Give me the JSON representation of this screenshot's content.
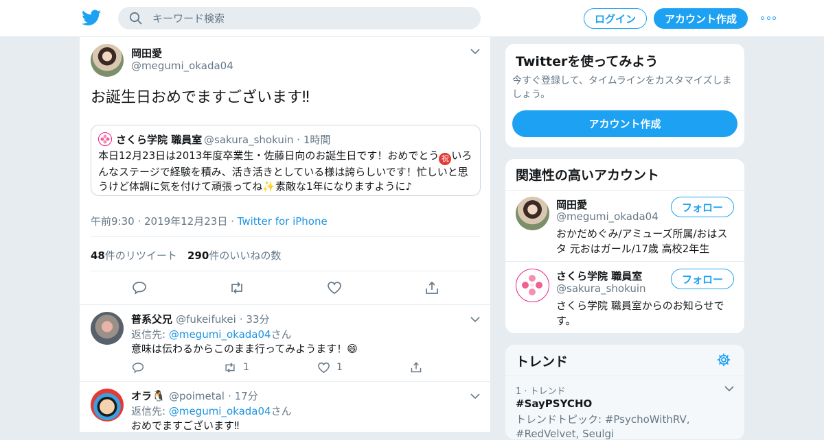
{
  "header": {
    "search_placeholder": "キーワード検索",
    "login_label": "ログイン",
    "signup_label": "アカウント作成"
  },
  "tweet": {
    "author_name": "岡田愛",
    "author_handle": "@megumi_okada04",
    "text": "お誕生日おめでますございます‼",
    "quote": {
      "author_name": "さくら学院 職員室",
      "author_handle": "@sakura_shokuin",
      "time": "1時間",
      "text_1": "本日12月23日は2013年度卒業生・佐藤日向のお誕生日です！おめでとう",
      "iwai": "祝",
      "text_2": "いろんなステージで経験を積み、活き活きとしている様は誇らしいです！忙しいと思うけど体調に気を付けて頑張ってね",
      "sparkle": "✨",
      "text_3": "素敵な1年になりますように♪"
    },
    "timestamp": "午前9:30 · 2019年12月23日",
    "source": "Twitter for iPhone",
    "retweets_count": "48",
    "retweets_label": "件のリツイート",
    "likes_count": "290",
    "likes_label": "件のいいねの数"
  },
  "replies": [
    {
      "name": "普系父兄",
      "handle": "@fukeifukei",
      "time": "33分",
      "reply_prefix": "返信先: ",
      "reply_to": "@megumi_okada04",
      "reply_suffix": "さん",
      "text": "意味は伝わるからこのまま行ってみようます！",
      "emoji": "😄",
      "retweets": "1",
      "likes": "1"
    },
    {
      "name": "オラ",
      "emoji": "🐧",
      "handle": "@poimetal",
      "time": "17分",
      "reply_prefix": "返信先: ",
      "reply_to": "@megumi_okada04",
      "reply_suffix": "さん",
      "text": "おめでますございます‼"
    }
  ],
  "signup_card": {
    "title": "Twitterを使ってみよう",
    "subtitle": "今すぐ登録して、タイムラインをカスタマイズしましょう。",
    "button": "アカウント作成"
  },
  "related": {
    "title": "関連性の高いアカウント",
    "accounts": [
      {
        "name": "岡田愛",
        "handle": "@megumi_okada04",
        "bio": "おかだめぐみ/アミューズ所属/おはスタ 元おはガール/17歳 高校2年生",
        "follow": "フォロー"
      },
      {
        "name": "さくら学院 職員室",
        "handle": "@sakura_shokuin",
        "bio": "さくら学院 職員室からのお知らせです。",
        "follow": "フォロー"
      }
    ]
  },
  "trends": {
    "title": "トレンド",
    "items": [
      {
        "meta": "1 · トレンド",
        "tag": "#SayPSYCHO",
        "topic": "トレンドトピック: #PsychoWithRV, #RedVelvet, Seulgi"
      }
    ]
  },
  "colors": {
    "accent": "#1da1f2",
    "link": "#1b95e0",
    "background": "#e6ecf0"
  }
}
